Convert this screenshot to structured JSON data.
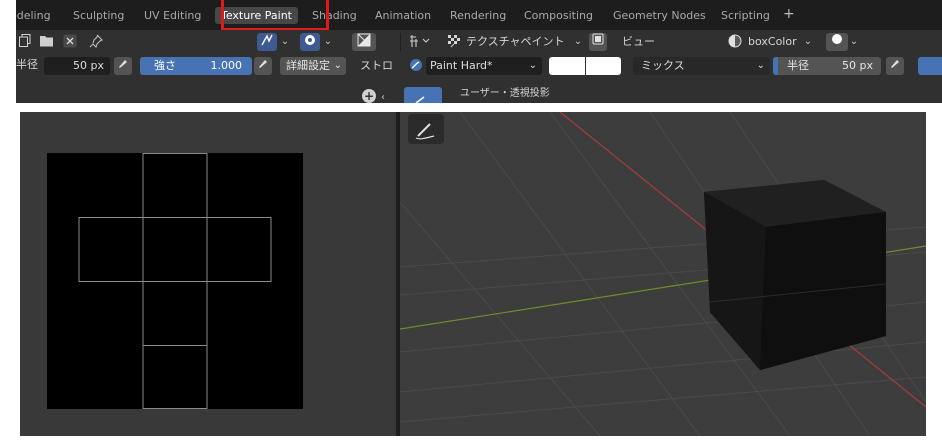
{
  "workspace_tabs": [
    {
      "label": "odeling"
    },
    {
      "label": "Sculpting"
    },
    {
      "label": "UV Editing"
    },
    {
      "label": "Texture Paint"
    },
    {
      "label": "Shading"
    },
    {
      "label": "Animation"
    },
    {
      "label": "Rendering"
    },
    {
      "label": "Compositing"
    },
    {
      "label": "Geometry Nodes"
    },
    {
      "label": "Scripting"
    }
  ],
  "add_workspace": "+",
  "active_tab": "Texture Paint",
  "image_toolbar": {
    "radius_label": "半径",
    "radius_value": "50 px",
    "strength_label": "強さ",
    "strength_value": "1.000",
    "advanced_label": "詳細設定",
    "stroke_label": "ストロ"
  },
  "viewport_header": {
    "mode_label": "テクスチャペイント",
    "view_menu": "ビュー",
    "material_slot": "boxColor",
    "brush_name": "Paint Hard*",
    "blend_mode": "ミックス",
    "radius_label": "半径",
    "radius_value": "50 px",
    "view_label": "ユーザー・透視投影"
  },
  "colors": {
    "accent_blue": "#4772b3",
    "highlight_red": "#e01a1a",
    "axis_red": "#a83a3a",
    "axis_green": "#6b8f2a"
  }
}
